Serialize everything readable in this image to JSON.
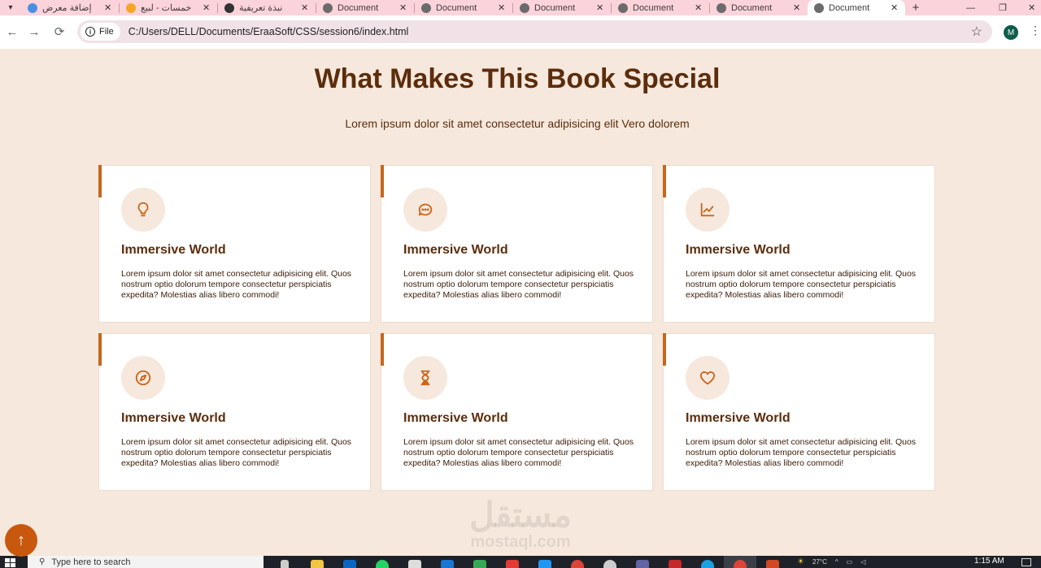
{
  "browser": {
    "tabs": [
      {
        "title": "إضافة معرض",
        "favicon_color": "#4a90e2",
        "active": false
      },
      {
        "title": "خمسات - لبيع",
        "favicon_color": "#f5a623",
        "active": false
      },
      {
        "title": "نبذة تعريفية",
        "favicon_color": "#333333",
        "active": false
      },
      {
        "title": "Document",
        "favicon_color": "#6b6b6b",
        "active": false
      },
      {
        "title": "Document",
        "favicon_color": "#6b6b6b",
        "active": false
      },
      {
        "title": "Document",
        "favicon_color": "#6b6b6b",
        "active": false
      },
      {
        "title": "Document",
        "favicon_color": "#6b6b6b",
        "active": false
      },
      {
        "title": "Document",
        "favicon_color": "#6b6b6b",
        "active": false
      },
      {
        "title": "Document",
        "favicon_color": "#6b6b6b",
        "active": true
      }
    ],
    "new_tab_glyph": "+",
    "close_glyph": "✕",
    "file_chip_label": "File",
    "url": "C:/Users/DELL/Documents/EraaSoft/CSS/session6/index.html",
    "profile_initial": "M"
  },
  "page": {
    "heading": "What Makes This Book Special",
    "subheading": "Lorem ipsum dolor sit amet consectetur adipisicing elit Vero dolorem",
    "accent_color": "#c8661c",
    "heading_color": "#5c2d0c",
    "cards": [
      {
        "icon": "lightbulb-icon",
        "title": "Immersive World",
        "description": "Lorem ipsum dolor sit amet consectetur adipisicing elit. Quos nostrum optio dolorum tempore consectetur perspiciatis expedita? Molestias alias libero commodi!"
      },
      {
        "icon": "chat-icon",
        "title": "Immersive World",
        "description": "Lorem ipsum dolor sit amet consectetur adipisicing elit. Quos nostrum optio dolorum tempore consectetur perspiciatis expedita? Molestias alias libero commodi!"
      },
      {
        "icon": "chart-line-icon",
        "title": "Immersive World",
        "description": "Lorem ipsum dolor sit amet consectetur adipisicing elit. Quos nostrum optio dolorum tempore consectetur perspiciatis expedita? Molestias alias libero commodi!"
      },
      {
        "icon": "compass-icon",
        "title": "Immersive World",
        "description": "Lorem ipsum dolor sit amet consectetur adipisicing elit. Quos nostrum optio dolorum tempore consectetur perspiciatis expedita? Molestias alias libero commodi!"
      },
      {
        "icon": "hourglass-icon",
        "title": "Immersive World",
        "description": "Lorem ipsum dolor sit amet consectetur adipisicing elit. Quos nostrum optio dolorum tempore consectetur perspiciatis expedita? Molestias alias libero commodi!"
      },
      {
        "icon": "heart-icon",
        "title": "Immersive World",
        "description": "Lorem ipsum dolor sit amet consectetur adipisicing elit. Quos nostrum optio dolorum tempore consectetur perspiciatis expedita? Molestias alias libero commodi!"
      }
    ],
    "watermark_ar": "مستقل",
    "watermark_en": "mostaql.com",
    "scroll_top_glyph": "↑"
  },
  "taskbar": {
    "search_placeholder": "Type here to search",
    "weather": "27°C",
    "clock": "1:15 AM"
  }
}
